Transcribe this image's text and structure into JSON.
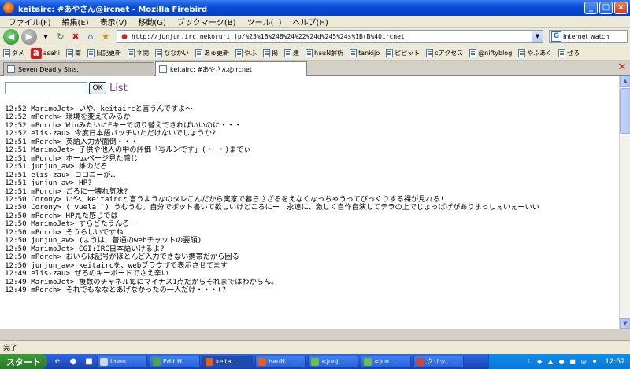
{
  "window": {
    "title": "keitairc: #あやさん@ircnet - Mozilla Firebird",
    "buttons": [
      "_",
      "□",
      "×"
    ]
  },
  "menu": [
    "ファイル(F)",
    "編集(E)",
    "表示(V)",
    "移動(G)",
    "ブックマーク(B)",
    "ツール(T)",
    "ヘルプ(H)"
  ],
  "nav": {
    "url": "http://junjun.irc.nekoruri.jp/%23%1B%24B%24%22%24d%245%24s%1B(B%40ircnet",
    "search_value": "Internet watch"
  },
  "bookmarks": [
    "ダメ",
    "asahi",
    "南",
    "日記更新",
    "ネ関",
    "ななかい",
    "あゅ更新",
    "やふ",
    "掲",
    "建",
    "hauN解析",
    "tankijo",
    "ピピット",
    "cアクセス",
    "@niftyblog",
    "やふあく",
    "ぜろ"
  ],
  "tabs": [
    {
      "label": "Seven Deadly Sins.",
      "active": false
    },
    {
      "label": "keitairc: #あやさん@ircnet",
      "active": true
    }
  ],
  "form": {
    "ok_label": "OK",
    "list_label": "List"
  },
  "log": [
    "12:52 MarimoJet> いや、keitaircと言うんですよ〜",
    "12:52 mPorch> 環境を変えてみるか",
    "12:52 mPorch> WinみたいにFキーで切り替えできればいいのに・・・",
    "12:52 elis-zau> 今度日本語パッチいただけないでしょうか?",
    "12:51 mPorch> 英語入力が面倒・・・",
    "12:51 MarimoJet> 子供や他人の中の評価「写ルンです」(・_・)までぃ",
    "12:51 mPorch> ホームページ見た感じ",
    "12:51 junjun_aw> 誰のだろ",
    "12:51 elis-zau> コロニーが…",
    "12:51 junjun_aw> HP?",
    "12:51 mPorch> ごろに一壊れ気味?",
    "12:50 Corony> いや、keitaircと言うようなのタレこんだから実家で暮らさざるをえなくなっちゃうってびっくりする裸が見れる!",
    "12:50 Corony> ( vuela``) うむうむ。自分でボット書いて欲しいけどころにー　永遠に、激しく自作自演してテラの上でじょっぱげがありまっしぇいぇーいい",
    "12:50 mPorch> HP見た感じでは",
    "12:50 MarimoJet> すらどたうんろー",
    "12:50 mPorch> そうらしいですね",
    "12:50 junjun_aw> (ようは、普通のwebチャットの要領)",
    "12:50 MarimoJet> CGI:IRC日本語いけるよ?",
    "12:50 mPorch> おいらは記号がほとんど入力できない携帯だから困る",
    "12:50 junjun_aw> keitaircを、webブラウザで表示させてます",
    "12:49 elis-zau> ぜろのキーボードでさえ辛い",
    "12:49 MarimoJet> 複数のチャネル毎にマイナス1点だからそれまではわからん。",
    "12:49 mPorch> それでもななとあげなかったの一人だけ・・・(?"
  ],
  "status": "完了",
  "taskbar": {
    "start_label": "スタート",
    "tasks": [
      "imou....",
      "Edit H...",
      "keitai...",
      "hauN ...",
      "<junj...",
      "<jun...",
      "クリッ..."
    ],
    "clock": "12:52"
  }
}
